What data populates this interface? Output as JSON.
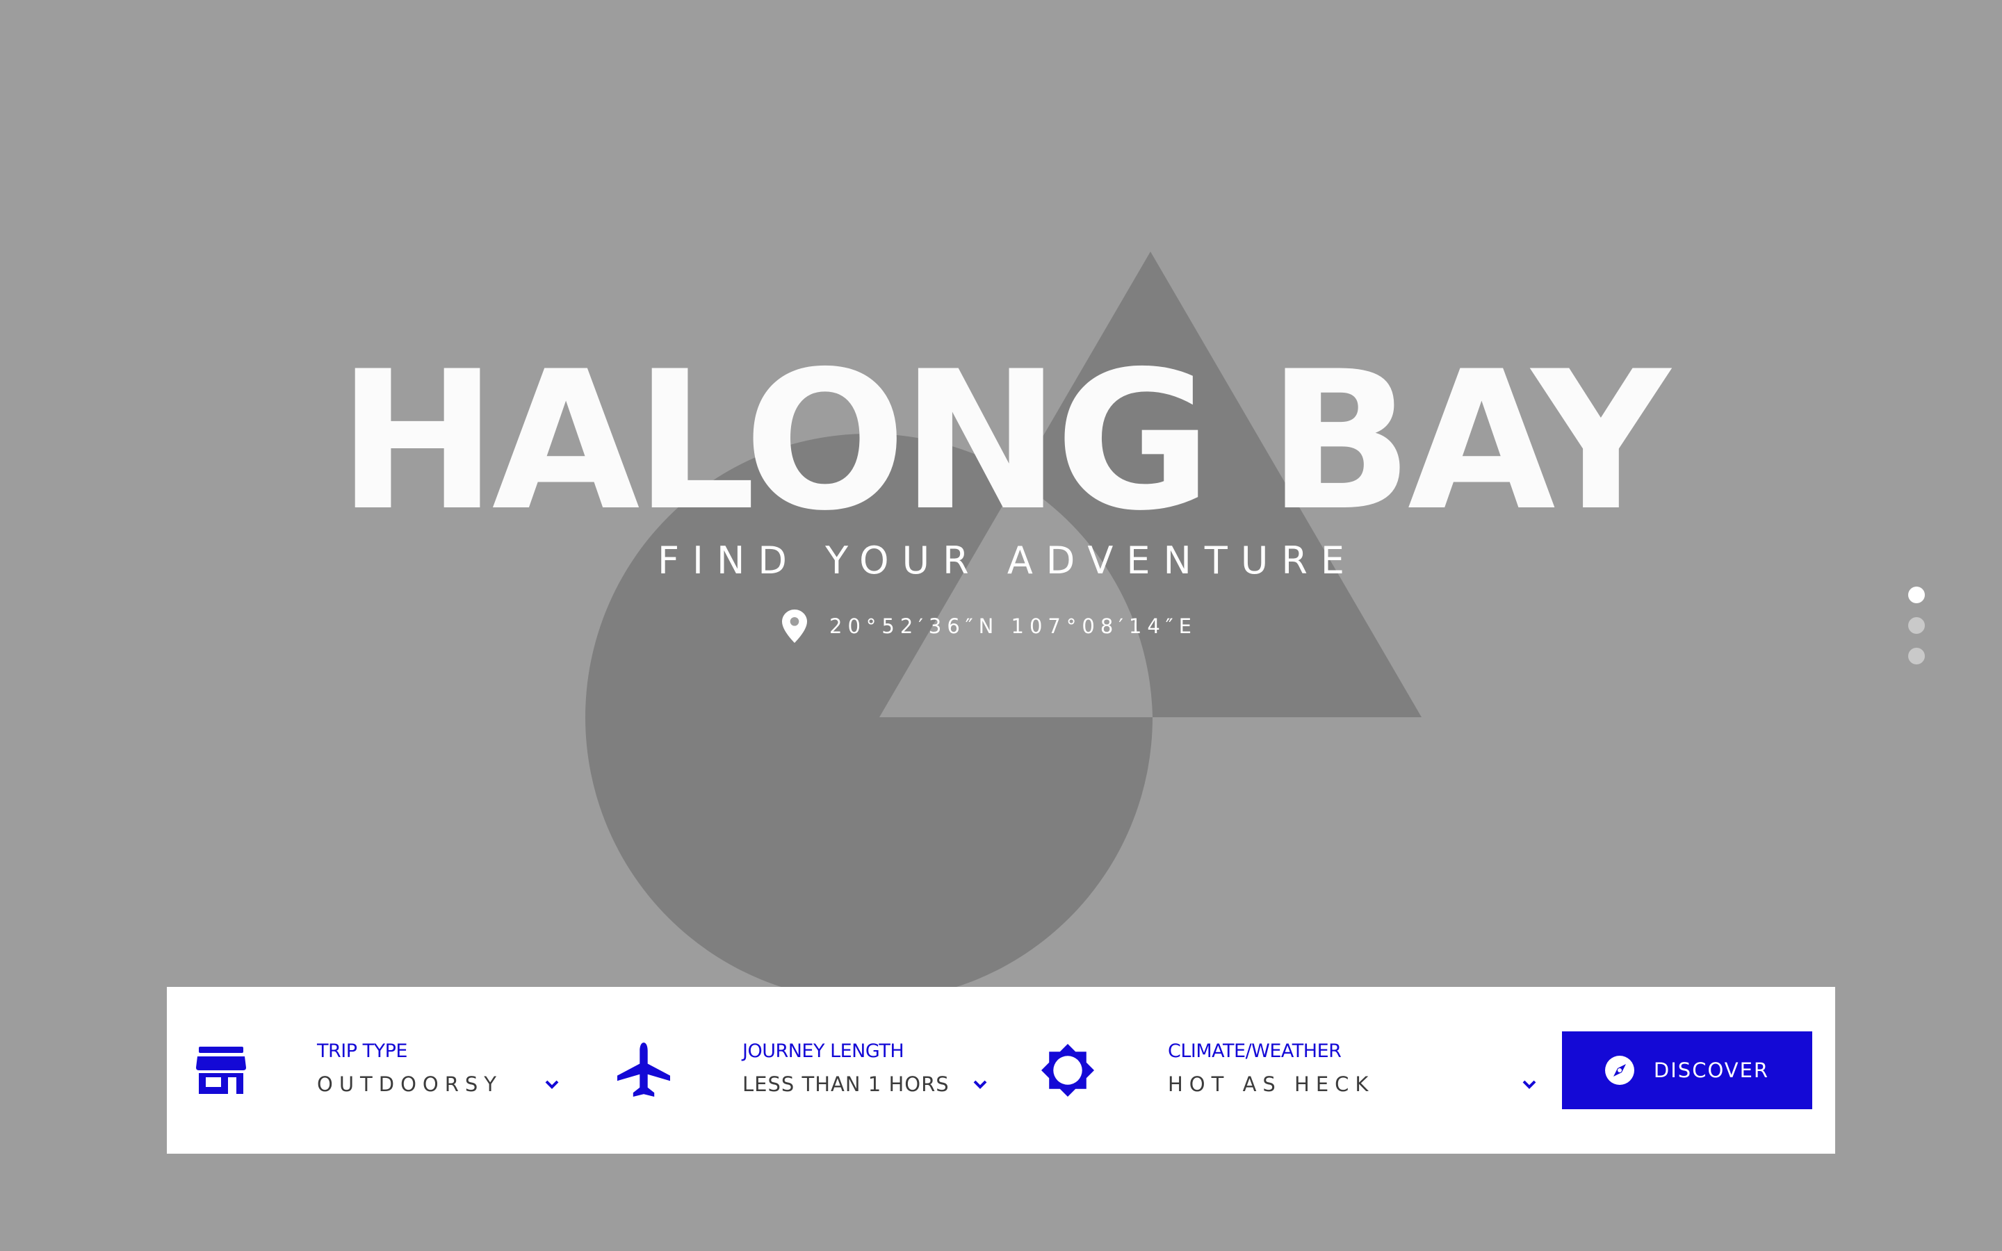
{
  "hero": {
    "title": "HALONG BAY",
    "subtitle": "FIND YOUR ADVENTURE",
    "coordinates": "20°52′36″N 107°08′14″E",
    "background_color": "#9d9d9d",
    "shape_color": "#7f7f7f"
  },
  "pager": {
    "count": 3,
    "active_index": 0
  },
  "search": {
    "accent_color": "#1409d6",
    "fields": [
      {
        "label": "TRIP TYPE",
        "value": "OUTDOORSY",
        "icon": "store-icon"
      },
      {
        "label": "JOURNEY LENGTH",
        "value": "LESS THAN 1 HORS",
        "icon": "airplane-icon"
      },
      {
        "label": "CLIMATE/WEATHER",
        "value": "HOT AS HECK",
        "icon": "sun-icon"
      }
    ],
    "button_label": "DISCOVER",
    "button_icon": "compass-icon"
  }
}
